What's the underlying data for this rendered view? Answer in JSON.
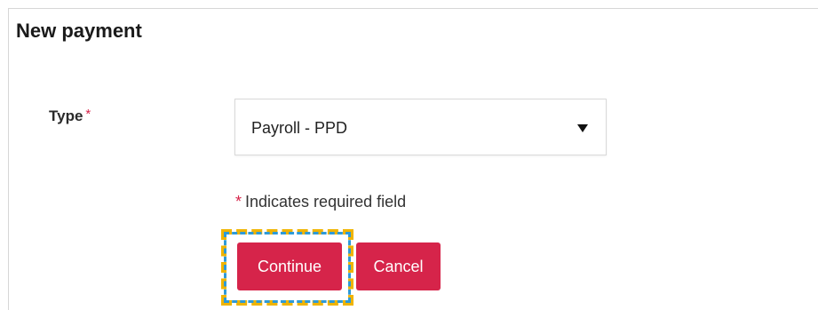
{
  "form": {
    "title": "New payment",
    "type_label": "Type",
    "required_marker": "*",
    "type_select": {
      "selected_value": "Payroll - PPD"
    },
    "required_note": "Indicates required field",
    "buttons": {
      "continue_label": "Continue",
      "cancel_label": "Cancel"
    }
  },
  "colors": {
    "accent": "#d6244a",
    "focus_yellow": "#f0b400",
    "focus_blue": "#2e9ad8"
  }
}
